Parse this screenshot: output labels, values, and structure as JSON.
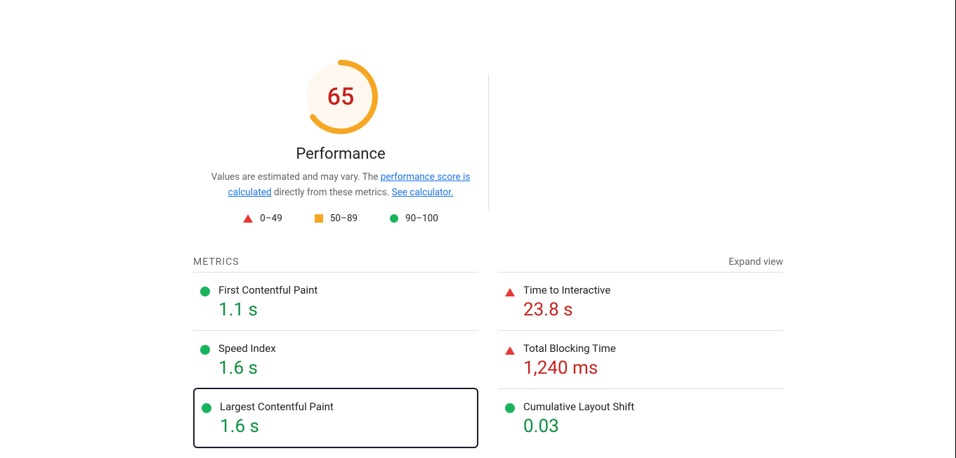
{
  "gauge": {
    "score": "65",
    "score_pct": 65,
    "title": "Performance",
    "desc_prefix": "Values are estimated and may vary. The ",
    "desc_link1": "performance score is calculated",
    "desc_mid": " directly from these metrics. ",
    "desc_link2": "See calculator."
  },
  "legend": {
    "bad": "0–49",
    "mid": "50–89",
    "good": "90–100"
  },
  "metrics": {
    "header": "METRICS",
    "expand": "Expand view",
    "items": [
      {
        "name": "First Contentful Paint",
        "value": "1.1 s",
        "status": "green"
      },
      {
        "name": "Time to Interactive",
        "value": "23.8 s",
        "status": "red"
      },
      {
        "name": "Speed Index",
        "value": "1.6 s",
        "status": "green"
      },
      {
        "name": "Total Blocking Time",
        "value": "1,240 ms",
        "status": "red"
      },
      {
        "name": "Largest Contentful Paint",
        "value": "1.6 s",
        "status": "green",
        "selected": true
      },
      {
        "name": "Cumulative Layout Shift",
        "value": "0.03",
        "status": "green"
      }
    ]
  },
  "chart_data": {
    "type": "gauge",
    "title": "Performance",
    "value": 65,
    "range": [
      0,
      100
    ],
    "bands": [
      {
        "label": "0–49",
        "color": "#e53935"
      },
      {
        "label": "50–89",
        "color": "#f5a623"
      },
      {
        "label": "90–100",
        "color": "#19b35e"
      }
    ]
  }
}
